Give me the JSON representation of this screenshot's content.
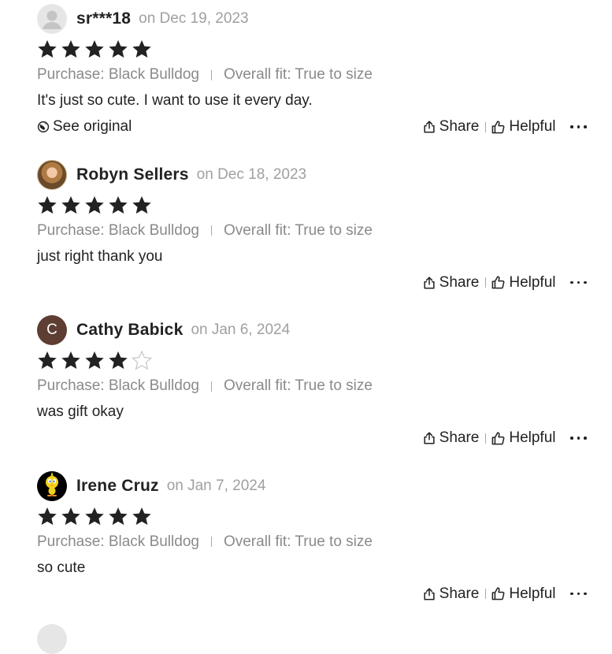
{
  "reviews": [
    {
      "avatar": {
        "type": "placeholder",
        "letter": "",
        "icon": "default-user-icon"
      },
      "name": "sr***18",
      "date": "on Dec 19, 2023",
      "rating": 5,
      "purchase": "Purchase: Black Bulldog",
      "fit": "Overall fit: True to size",
      "text": "It's just so cute. I want to use it every day.",
      "see_original": "See original",
      "share_label": "Share",
      "helpful_label": "Helpful"
    },
    {
      "avatar": {
        "type": "photo",
        "letter": "",
        "icon": "user-photo"
      },
      "name": "Robyn Sellers",
      "date": "on Dec 18, 2023",
      "rating": 5,
      "purchase": "Purchase: Black Bulldog",
      "fit": "Overall fit: True to size",
      "text": "just right thank you",
      "see_original": "",
      "share_label": "Share",
      "helpful_label": "Helpful"
    },
    {
      "avatar": {
        "type": "letter",
        "letter": "C",
        "icon": ""
      },
      "name": "Cathy Babick",
      "date": "on Jan 6, 2024",
      "rating": 4,
      "purchase": "Purchase: Black Bulldog",
      "fit": "Overall fit: True to size",
      "text": "was gift okay",
      "see_original": "",
      "share_label": "Share",
      "helpful_label": "Helpful"
    },
    {
      "avatar": {
        "type": "cartoon",
        "letter": "",
        "icon": "cartoon-bird-avatar"
      },
      "name": "Irene Cruz",
      "date": "on Jan 7, 2024",
      "rating": 5,
      "purchase": "Purchase: Black Bulldog",
      "fit": "Overall fit: True to size",
      "text": "so cute",
      "see_original": "",
      "share_label": "Share",
      "helpful_label": "Helpful"
    }
  ],
  "colors": {
    "star_filled": "#222222",
    "star_empty": "#c8c8c8",
    "muted_text": "#8a8a8a",
    "date_text": "#a0a0a0",
    "letter_avatar_bg": "#5e3d33"
  }
}
